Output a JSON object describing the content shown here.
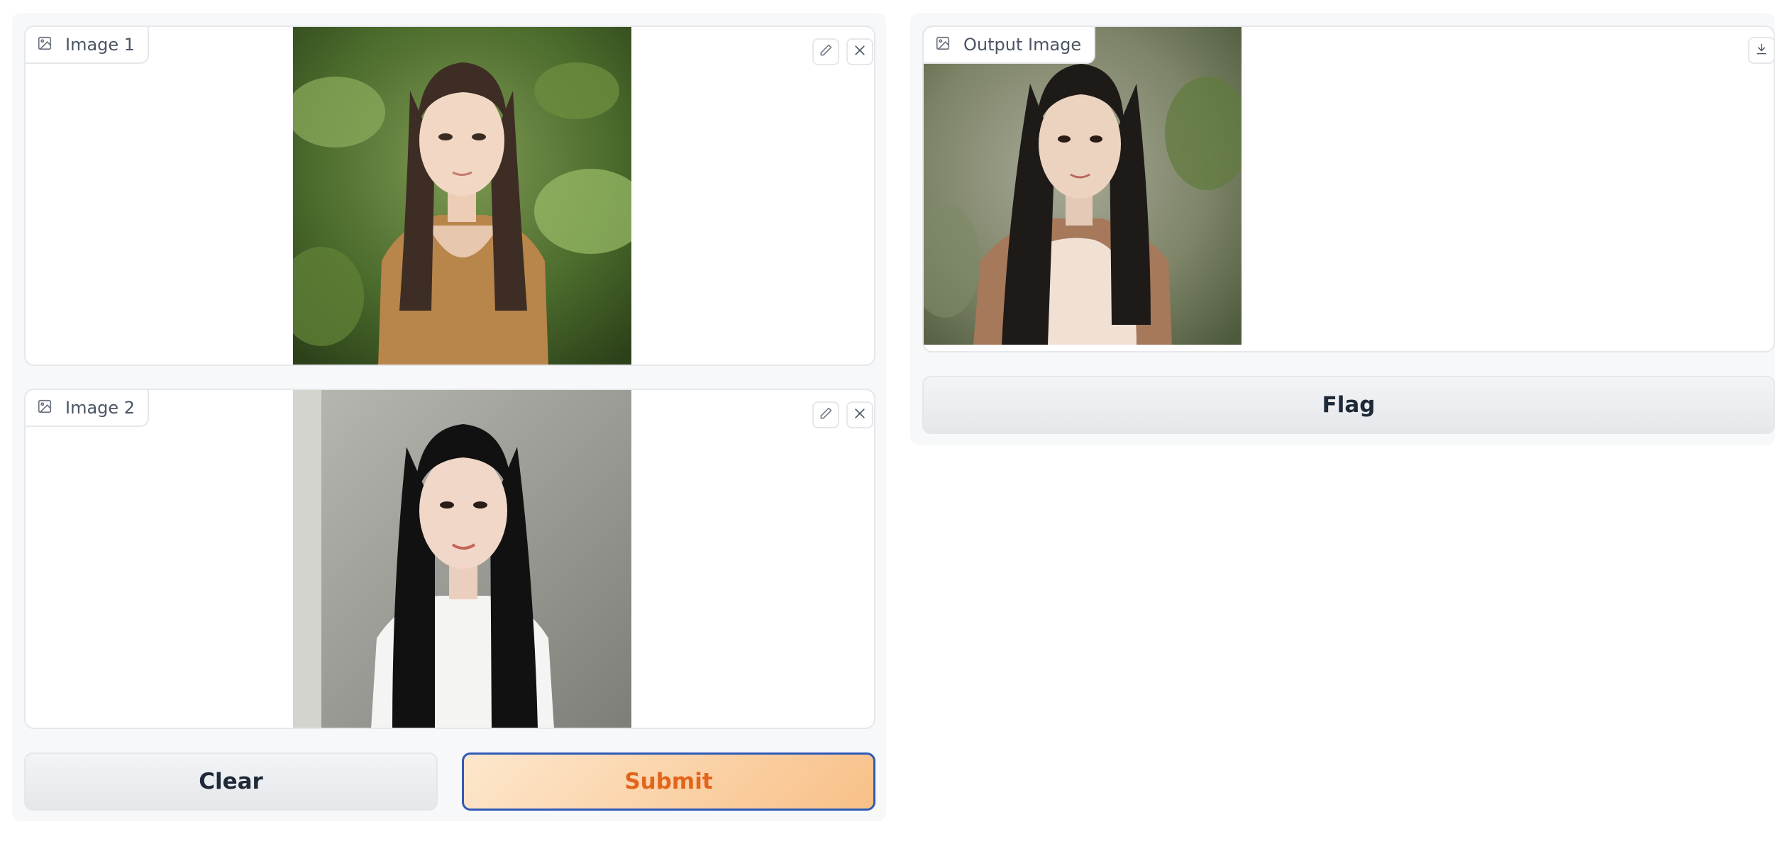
{
  "inputs": {
    "image1": {
      "label": "Image 1"
    },
    "image2": {
      "label": "Image 2"
    }
  },
  "output": {
    "label": "Output Image"
  },
  "buttons": {
    "clear": "Clear",
    "submit": "Submit",
    "flag": "Flag"
  },
  "icons": {
    "image_label": "image-icon",
    "edit": "pencil-icon",
    "remove": "close-icon",
    "download": "download-icon"
  },
  "colors": {
    "primary_text": "#e2651b",
    "primary_border": "#2f5ab7",
    "primary_bg_start": "#fde7cd",
    "primary_bg_end": "#f8c087",
    "panel_bg": "#f7f8fa"
  }
}
